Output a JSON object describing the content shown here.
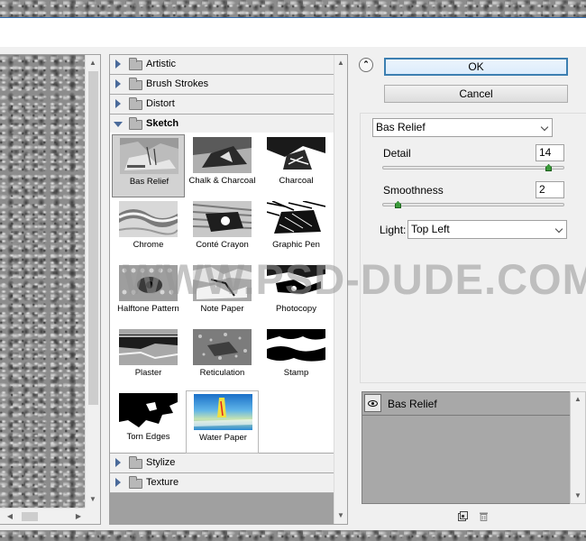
{
  "buttons": {
    "ok": "OK",
    "cancel": "Cancel"
  },
  "gallery": {
    "categories_above": [
      {
        "label": "Artistic",
        "expanded": false
      },
      {
        "label": "Brush Strokes",
        "expanded": false
      },
      {
        "label": "Distort",
        "expanded": false
      }
    ],
    "open_category": {
      "label": "Sketch",
      "expanded": true
    },
    "categories_below": [
      {
        "label": "Stylize",
        "expanded": false
      },
      {
        "label": "Texture",
        "expanded": false
      }
    ],
    "sketch_filters": [
      "Bas Relief",
      "Chalk & Charcoal",
      "Charcoal",
      "Chrome",
      "Conté Crayon",
      "Graphic Pen",
      "Halftone Pattern",
      "Note Paper",
      "Photocopy",
      "Plaster",
      "Reticulation",
      "Stamp",
      "Torn Edges",
      "Water Paper"
    ],
    "selected_filter": "Bas Relief"
  },
  "settings": {
    "filter_dropdown": "Bas Relief",
    "detail_label": "Detail",
    "detail_value": "14",
    "detail_min": 1,
    "detail_max": 15,
    "smoothness_label": "Smoothness",
    "smoothness_value": "2",
    "smoothness_min": 1,
    "smoothness_max": 15,
    "light_label": "Light:",
    "light_value": "Top Left"
  },
  "layers": {
    "items": [
      {
        "label": "Bas Relief",
        "visible": true
      }
    ]
  },
  "icons": {
    "collapse_toggle": "collapse-chevron-icon",
    "new_layer": "new-layer-icon",
    "delete_layer": "trash-icon",
    "layer_visibility": "eye-icon"
  },
  "watermark": "WWW.PSD-DUDE.COM",
  "colors": {
    "accent": "#3c7fb1",
    "slider_thumb": "#3a9a3a",
    "category_arrow": "#4a6a9a"
  }
}
